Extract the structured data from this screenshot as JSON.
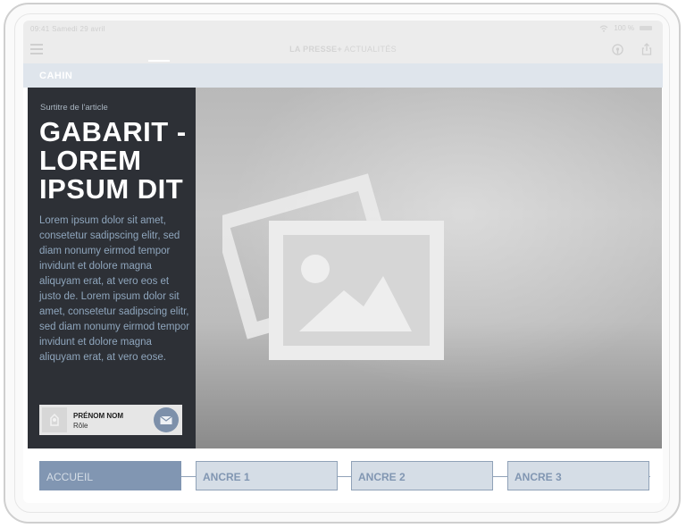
{
  "status_bar": {
    "time": "09:41",
    "date": "Samedi 29 avril",
    "battery": "100 %"
  },
  "navbar": {
    "brand_name": "LA PRESSE+",
    "brand_section": "ACTUALITÉS"
  },
  "section": {
    "label": "CAHIN"
  },
  "article": {
    "surtitre": "Surtitre de l'article",
    "headline": "GABARIT - LOREM IPSUM DIT",
    "body": "Lorem ipsum dolor sit amet, consetetur sadipscing elitr, sed diam nonumy eirmod tempor invidunt et dolore magna aliquyam erat, at vero eos et justo de. Lorem ipsum dolor sit amet, consetetur sadipscing elitr, sed diam nonumy eirmod tempor invidunt et dolore magna aliquyam erat, at vero eose.",
    "author": {
      "name": "PRÉNOM NOM",
      "role": "Rôle"
    }
  },
  "anchors": [
    {
      "label": "ACCUEIL",
      "active": true
    },
    {
      "label": "ANCRE 1",
      "active": false
    },
    {
      "label": "ANCRE 2",
      "active": false
    },
    {
      "label": "ANCRE 3",
      "active": false
    }
  ],
  "icons": [
    "menu-icon",
    "wifi-icon",
    "battery-icon",
    "podcast-icon",
    "share-icon",
    "image-placeholder-icon",
    "mail-icon",
    "avatar-placeholder-icon"
  ],
  "colors": {
    "panel": "#2d3036",
    "accent": "#8196b2",
    "anchor_bg": "#d5dde6",
    "section_bar": "#dfe5ec"
  }
}
